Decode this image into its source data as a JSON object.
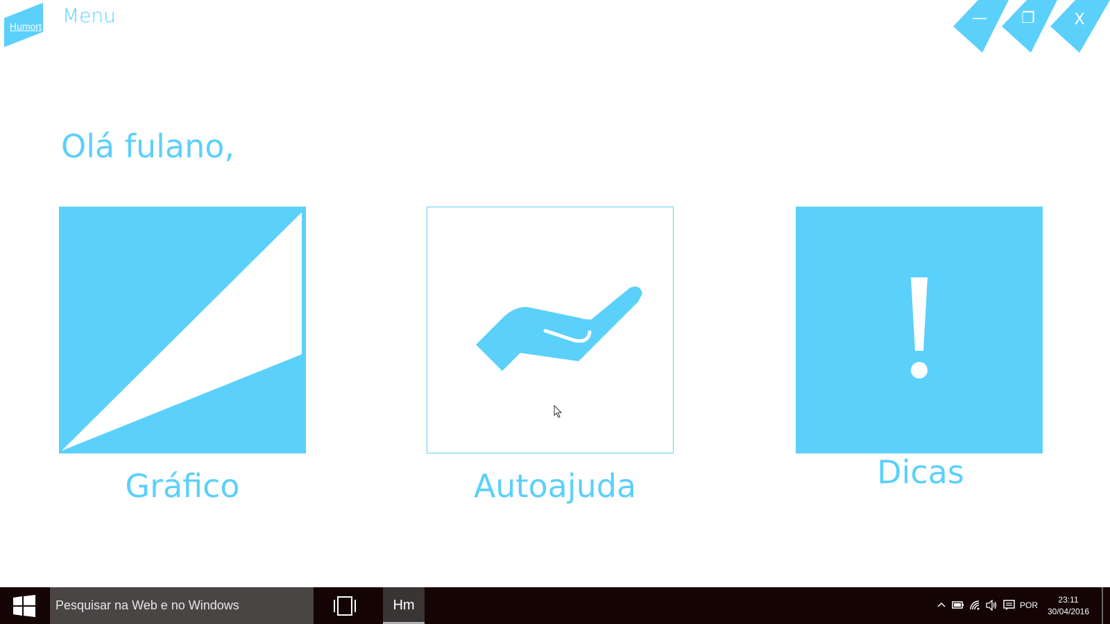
{
  "app": {
    "logo_text": "Humort",
    "header_title": "Menu",
    "greeting": "Olá fulano,",
    "window_controls": {
      "minimize_glyph": "—",
      "maximize_glyph": "❐",
      "close_glyph": "X"
    },
    "tiles": [
      {
        "label": "Gráfico",
        "icon": "chart-icon"
      },
      {
        "label": "Autoajuda",
        "icon": "hand-icon"
      },
      {
        "label": "Dicas",
        "icon": "exclamation-icon"
      }
    ],
    "colors": {
      "accent": "#5bd0fb",
      "background": "#ffffff"
    }
  },
  "taskbar": {
    "search_placeholder": "Pesquisar na Web e no Windows",
    "app_button_label": "Hm",
    "language": "POR",
    "time": "23:11",
    "date": "30/04/2016",
    "colors": {
      "background": "#140404",
      "search": "#4a4545"
    }
  }
}
